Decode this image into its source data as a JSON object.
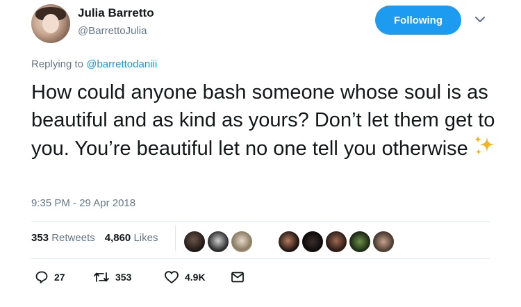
{
  "author": {
    "name": "Julia Barretto",
    "handle": "@BarrettoJulia"
  },
  "follow_button": {
    "label": "Following"
  },
  "reply": {
    "prefix": "Replying to ",
    "mention": "@barrettodaniii"
  },
  "tweet": {
    "text": "How could anyone bash someone whose soul is as beautiful and as kind as yours? Don’t let them get to you. You’re beautiful let no one tell you otherwise",
    "emoji": "sparkles-icon",
    "timestamp": "9:35 PM - 29 Apr 2018"
  },
  "stats": {
    "retweets_count": "353",
    "retweets_label": "Retweets",
    "likes_count": "4,860",
    "likes_label": "Likes"
  },
  "actions": {
    "replies": "27",
    "retweets": "353",
    "likes": "4.9K"
  },
  "colors": {
    "accent": "#1d9bf0",
    "secondary_text": "#657786",
    "primary_text": "#14171a",
    "divider": "#e1e8ed"
  }
}
